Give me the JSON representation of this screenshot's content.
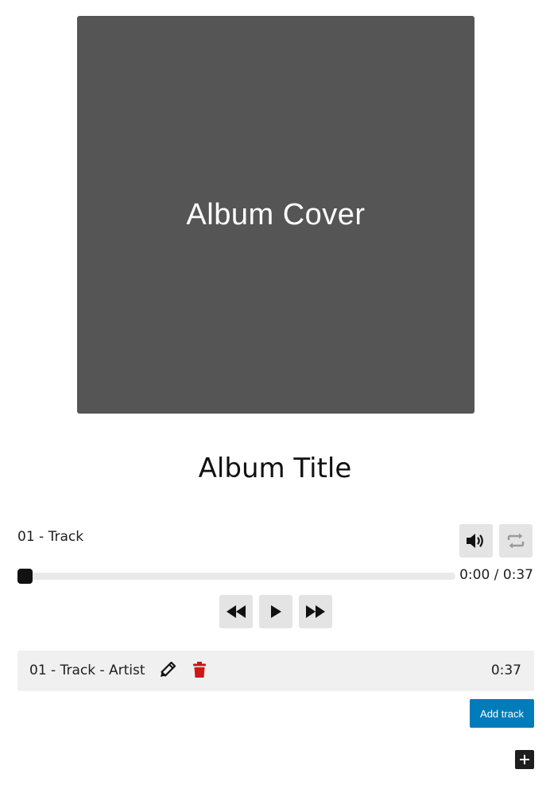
{
  "album": {
    "cover_placeholder": "Album Cover",
    "title": "Album Title"
  },
  "player": {
    "current_track": "01 - Track",
    "current_time": "0:00",
    "separator": "/",
    "total_time": "0:37",
    "progress": 0,
    "icons": {
      "volume": "volume-icon",
      "repeat": "repeat-icon",
      "previous": "rewind-icon",
      "play": "play-icon",
      "next": "fast-forward-icon"
    }
  },
  "tracklist": [
    {
      "label": "01 - Track - Artist",
      "duration": "0:37",
      "edit_icon": "pencil-icon",
      "delete_icon": "trash-icon"
    }
  ],
  "actions": {
    "add_track_label": "Add track",
    "add_block_icon": "plus-icon"
  },
  "colors": {
    "cover_bg": "#555555",
    "accent": "#007cba",
    "delete": "#cc1818",
    "button_bg": "#e4e4e4"
  }
}
